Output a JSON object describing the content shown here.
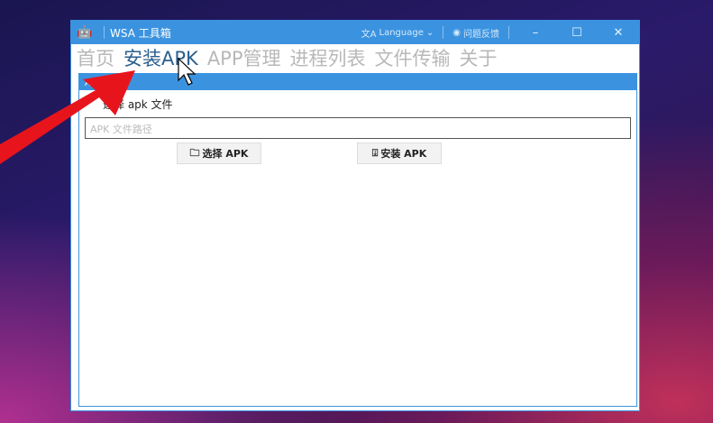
{
  "window": {
    "title": "WSA 工具箱",
    "language_label": "Language",
    "feedback_label": "问题反馈"
  },
  "tabs": [
    {
      "label": "首页"
    },
    {
      "label": "安装APK"
    },
    {
      "label": "APP管理"
    },
    {
      "label": "进程列表"
    },
    {
      "label": "文件传输"
    },
    {
      "label": "关于"
    }
  ],
  "panel": {
    "header": "APK 安装",
    "select_label": "选择 apk 文件",
    "path_placeholder": "APK 文件路径",
    "select_button": "选择 APK",
    "install_button": "安装 APK"
  },
  "colors": {
    "accent": "#3b93e0",
    "arrow": "#e8141c"
  }
}
